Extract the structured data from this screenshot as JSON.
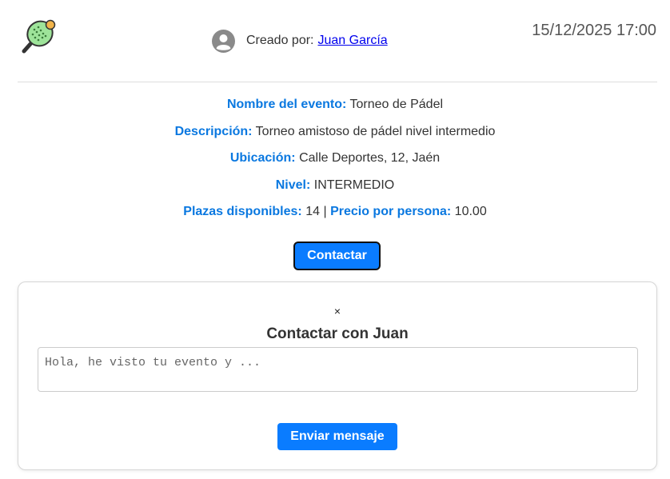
{
  "header": {
    "logo_icon": "padel-racket-icon",
    "creator_prefix": "Creado por:",
    "creator_name": "Juan García",
    "datetime": "15/12/2025 17:00"
  },
  "event": {
    "name_label": "Nombre del evento:",
    "name_value": "Torneo de Pádel",
    "description_label": "Descripción:",
    "description_value": "Torneo amistoso de pádel nivel intermedio",
    "location_label": "Ubicación:",
    "location_value": "Calle Deportes, 12, Jaén",
    "level_label": "Nivel:",
    "level_value": "INTERMEDIO",
    "spots_label": "Plazas disponibles:",
    "spots_value": "14",
    "separator": "|",
    "price_label": "Precio por persona:",
    "price_value": "10.00"
  },
  "actions": {
    "contact_label": "Contactar"
  },
  "modal": {
    "close_symbol": "×",
    "title": "Contactar con Juan",
    "message_placeholder": "Hola, he visto tu evento y ...",
    "message_value": "",
    "send_label": "Enviar mensaje"
  },
  "colors": {
    "accent": "#0a7cff",
    "label_blue": "#0a78e0",
    "link": "#0000ee"
  }
}
